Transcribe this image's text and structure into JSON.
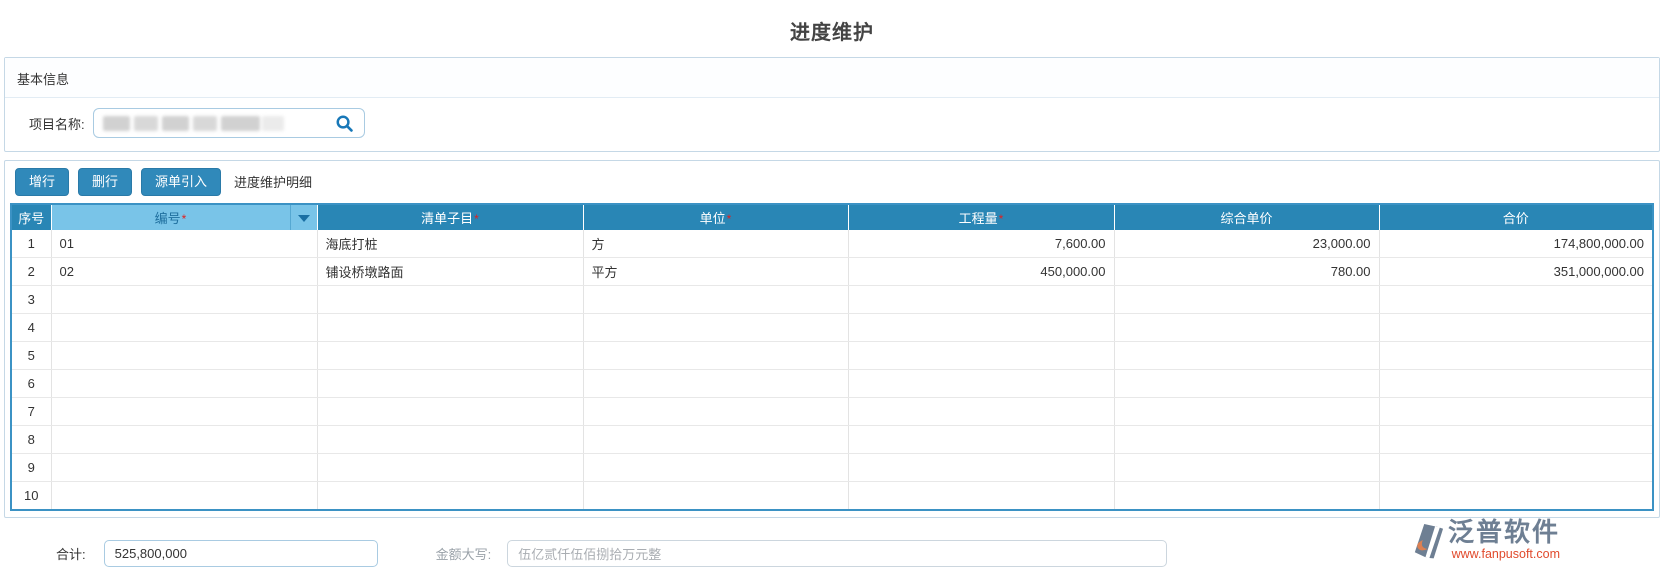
{
  "page": {
    "title": "进度维护"
  },
  "basic_info": {
    "section_title": "基本信息",
    "project_name_label": "项目名称:",
    "project_name_value": "",
    "search_icon": "magnifier"
  },
  "toolbar": {
    "add_row": "增行",
    "delete_row": "删行",
    "import_source": "源单引入",
    "detail_title": "进度维护明细"
  },
  "table": {
    "columns": [
      {
        "key": "seq",
        "label": "序号",
        "required": false,
        "align": "c",
        "selected": false
      },
      {
        "key": "code",
        "label": "编号",
        "required": true,
        "align": "l",
        "selected": true,
        "dropdown": true
      },
      {
        "key": "item",
        "label": "清单子目",
        "required": true,
        "align": "l",
        "selected": false
      },
      {
        "key": "unit",
        "label": "单位",
        "required": true,
        "align": "l",
        "selected": false
      },
      {
        "key": "quantity",
        "label": "工程量",
        "required": true,
        "align": "r",
        "selected": false
      },
      {
        "key": "unit_price",
        "label": "综合单价",
        "required": false,
        "align": "r",
        "selected": false
      },
      {
        "key": "total",
        "label": "合价",
        "required": false,
        "align": "r",
        "selected": false
      }
    ],
    "rows": [
      {
        "seq": "1",
        "code": "01",
        "item": "海底打桩",
        "unit": "方",
        "quantity": "7,600.00",
        "unit_price": "23,000.00",
        "total": "174,800,000.00"
      },
      {
        "seq": "2",
        "code": "02",
        "item": "铺设桥墩路面",
        "unit": "平方",
        "quantity": "450,000.00",
        "unit_price": "780.00",
        "total": "351,000,000.00"
      },
      {
        "seq": "3",
        "code": "",
        "item": "",
        "unit": "",
        "quantity": "",
        "unit_price": "",
        "total": ""
      },
      {
        "seq": "4",
        "code": "",
        "item": "",
        "unit": "",
        "quantity": "",
        "unit_price": "",
        "total": ""
      },
      {
        "seq": "5",
        "code": "",
        "item": "",
        "unit": "",
        "quantity": "",
        "unit_price": "",
        "total": ""
      },
      {
        "seq": "6",
        "code": "",
        "item": "",
        "unit": "",
        "quantity": "",
        "unit_price": "",
        "total": ""
      },
      {
        "seq": "7",
        "code": "",
        "item": "",
        "unit": "",
        "quantity": "",
        "unit_price": "",
        "total": ""
      },
      {
        "seq": "8",
        "code": "",
        "item": "",
        "unit": "",
        "quantity": "",
        "unit_price": "",
        "total": ""
      },
      {
        "seq": "9",
        "code": "",
        "item": "",
        "unit": "",
        "quantity": "",
        "unit_price": "",
        "total": ""
      },
      {
        "seq": "10",
        "code": "",
        "item": "",
        "unit": "",
        "quantity": "",
        "unit_price": "",
        "total": ""
      }
    ]
  },
  "footer": {
    "total_label": "合计:",
    "total_value": "525,800,000",
    "amount_words_label": "金额大写:",
    "amount_words_value": "伍亿贰仟伍佰捌拾万元整"
  },
  "branding": {
    "name": "泛普软件",
    "url": "www.fanpusoft.com"
  },
  "colors": {
    "header_bg": "#2986b5",
    "selected_column_bg": "#79c4e8",
    "button_bg": "#3089ba",
    "grid_border": "#3b92c4",
    "panel_border": "#c5d8e6",
    "required_asterisk": "#e02020",
    "brand_gray": "#6e7f93",
    "brand_red": "#e14b2d"
  }
}
